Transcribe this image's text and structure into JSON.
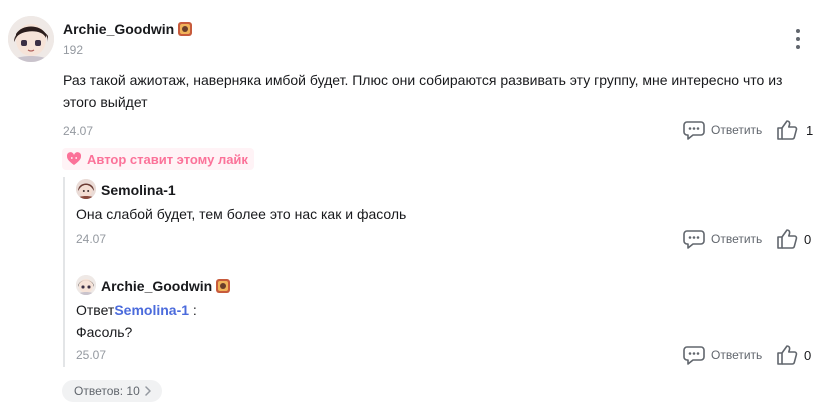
{
  "comment": {
    "author": "Archie_Goodwin",
    "level": "192",
    "text_line1": "Раз такой ажиотаж, наверняка имбой будет. Плюс они собираются развивать эту группу, мне интересно что из",
    "text_line2": "этого выйдет",
    "date": "24.07",
    "reply_label": "Ответить",
    "likes": "1",
    "author_liked": "Автор ставит этому лайк"
  },
  "replies": [
    {
      "author": "Semolina-1",
      "text": "Она слабой будет, тем более это нас как и фасоль",
      "date": "24.07",
      "reply_label": "Ответить",
      "likes": "0"
    },
    {
      "author": "Archie_Goodwin",
      "reply_prefix": "Ответ",
      "mention": "Semolina-1",
      "mention_sep": " :",
      "text": "Фасоль?",
      "date": "25.07",
      "reply_label": "Ответить",
      "likes": "0"
    }
  ],
  "replies_toggle": "Ответов: 10",
  "colors": {
    "accent_pink": "#fb7299",
    "mention_blue": "#4b6bdc",
    "muted": "#9499a0"
  },
  "icons": {
    "reply": "comment-bubble-icon",
    "like": "thumbs-up-icon",
    "more": "vertical-dots-icon",
    "liked_banner": "heart-face-icon",
    "toggle": "chevron-right-icon"
  }
}
